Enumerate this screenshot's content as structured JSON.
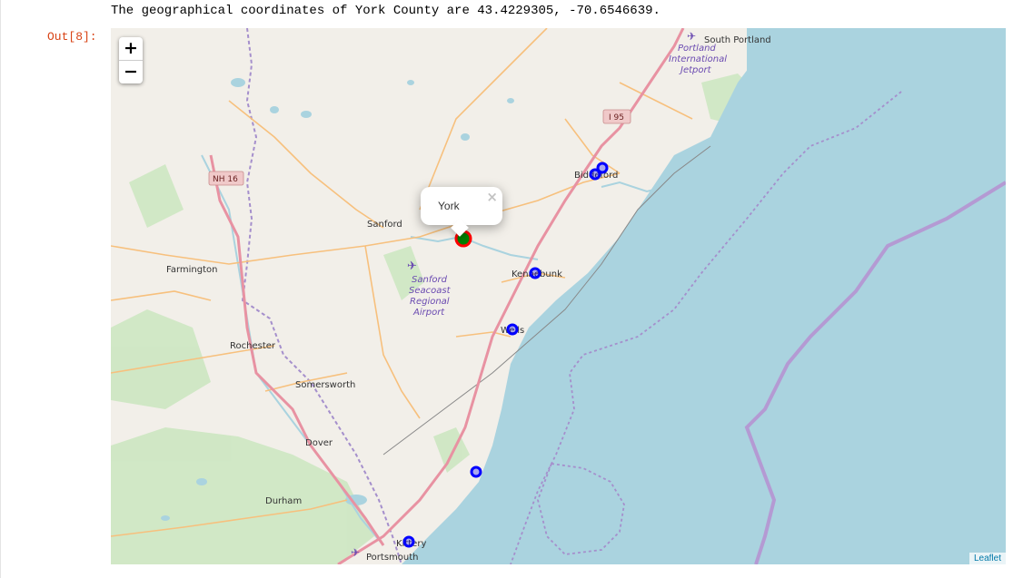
{
  "output_text": "The geographical coordinates of York County are 43.4229305, -70.6546639.",
  "out_prompt": "Out[8]:",
  "map": {
    "zoom_in_label": "+",
    "zoom_out_label": "−",
    "attribution": "Leaflet",
    "popup": {
      "text": "York",
      "close_glyph": "×"
    },
    "colors": {
      "land": "#f2efe9",
      "water": "#aad3df",
      "boundary": "#a58fcc",
      "highway": "#e892a2",
      "road": "#f7c07d",
      "marker_blue": "#0000ff",
      "marker_center_fill": "#008000",
      "marker_center_ring": "#ff0000"
    },
    "places": [
      "South Portland",
      "Biddeford",
      "Sanford",
      "Farmington",
      "Kennebunk",
      "Wells",
      "Rochester",
      "Somersworth",
      "Dover",
      "Durham",
      "Kittery",
      "Portsmouth"
    ],
    "airport_labels": [
      "Portland",
      "International",
      "Jetport",
      "Sanford",
      "Seacoast",
      "Regional",
      "Airport"
    ],
    "route_shields": [
      "NH 16",
      "I 95"
    ]
  }
}
